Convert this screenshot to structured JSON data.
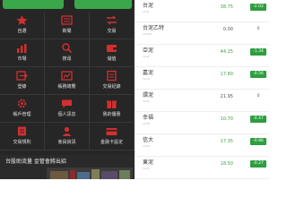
{
  "menu": {
    "colors": {
      "panel": "#262626",
      "icon": "#d32f2f",
      "label": "#e0e0e0",
      "top_button": "#3aa74a"
    },
    "tiles": [
      {
        "label": "自選",
        "icon": "star-icon"
      },
      {
        "label": "新聞",
        "icon": "newspaper-icon"
      },
      {
        "label": "交易",
        "icon": "exchange-icon"
      },
      {
        "label": "市場",
        "icon": "market-icon"
      },
      {
        "label": "搜尋",
        "icon": "search-icon"
      },
      {
        "label": "儲值",
        "icon": "wallet-icon"
      },
      {
        "label": "登錄",
        "icon": "login-icon"
      },
      {
        "label": "帳務總覽",
        "icon": "account-icon"
      },
      {
        "label": "交易紀錄",
        "icon": "record-icon"
      },
      {
        "label": "帳戶管理",
        "icon": "settings-icon"
      },
      {
        "label": "個人訊息",
        "icon": "message-icon"
      },
      {
        "label": "我的優惠",
        "icon": "gift-icon"
      },
      {
        "label": "交易規則",
        "icon": "rules-icon"
      },
      {
        "label": "會員資訊",
        "icon": "member-icon"
      },
      {
        "label": "金融卡設定",
        "icon": "card-icon"
      }
    ],
    "promo": {
      "title": "台股助流量 金管會將出招"
    }
  },
  "quotes": {
    "colors": {
      "down": "#2e9e3e",
      "price_down": "#43a047",
      "flat": "#555555"
    },
    "rows": [
      {
        "name": "台泥",
        "code": "1101",
        "price": "38.75",
        "change": "-2.02",
        "direction": "down"
      },
      {
        "name": "台泥乙特",
        "code": "1101B",
        "price": "0.00",
        "change": "0",
        "direction": "flat"
      },
      {
        "name": "亞泥",
        "code": "1102",
        "price": "44.25",
        "change": "-1.34",
        "direction": "down"
      },
      {
        "name": "嘉泥",
        "code": "1103",
        "price": "17.80",
        "change": "-0.56",
        "direction": "down"
      },
      {
        "name": "環泥",
        "code": "1104",
        "price": "21.95",
        "change": "0",
        "direction": "flat"
      },
      {
        "name": "幸福",
        "code": "1108",
        "price": "10.70",
        "change": "-0.47",
        "direction": "down"
      },
      {
        "name": "信大",
        "code": "1109",
        "price": "17.35",
        "change": "-0.86",
        "direction": "down"
      },
      {
        "name": "東泥",
        "code": "1110",
        "price": "18.50",
        "change": "-0.27",
        "direction": "down"
      }
    ]
  }
}
